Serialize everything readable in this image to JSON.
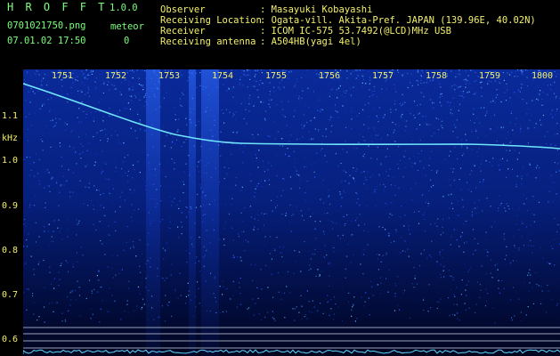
{
  "app": {
    "name": "H R O F F T",
    "version": "1.0.0",
    "filename": "0701021750.png",
    "datetime": "07.01.02 17:50",
    "meteor_label": "meteor",
    "meteor_count": "0"
  },
  "info": {
    "rows": [
      {
        "label": "Observer",
        "value": ": Masayuki Kobayashi"
      },
      {
        "label": "Receiving Location",
        "value": ": Ogata-vill. Akita-Pref. JAPAN (139.96E, 40.02N)"
      },
      {
        "label": "Receiver",
        "value": ": ICOM IC-575 53.7492(@LCD)MHz USB"
      },
      {
        "label": "Receiving antenna",
        "value": ": A504HB(yagi 4el)"
      }
    ]
  },
  "axes": {
    "y_unit": "kHz",
    "y_ticks": [
      "1.1",
      "1.0",
      "0.9",
      "0.8",
      "0.7",
      "0.6"
    ],
    "x_ticks": [
      "1751",
      "1752",
      "1753",
      "1754",
      "1755",
      "1756",
      "1757",
      "1758",
      "1759",
      "1800"
    ]
  },
  "colors": {
    "header_text": "#7cff7c",
    "axis_text": "#f3f06a",
    "background": "#000000",
    "spectrogram_base": "#061b7a",
    "trace": "#6fe6ff"
  }
}
